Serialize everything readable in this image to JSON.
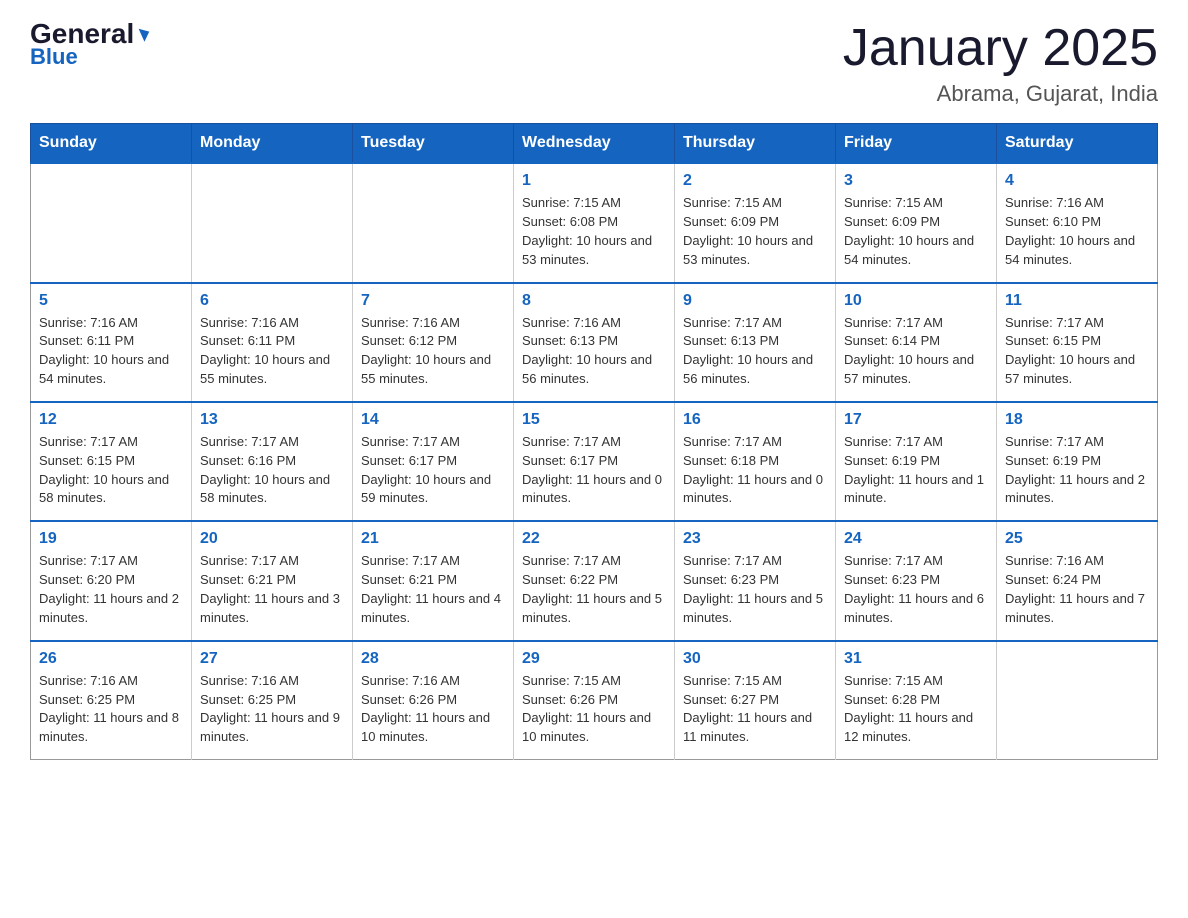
{
  "header": {
    "logo_line1": "General",
    "logo_line2": "Blue",
    "month_title": "January 2025",
    "location": "Abrama, Gujarat, India"
  },
  "days_of_week": [
    "Sunday",
    "Monday",
    "Tuesday",
    "Wednesday",
    "Thursday",
    "Friday",
    "Saturday"
  ],
  "weeks": [
    [
      {
        "day": "",
        "info": ""
      },
      {
        "day": "",
        "info": ""
      },
      {
        "day": "",
        "info": ""
      },
      {
        "day": "1",
        "info": "Sunrise: 7:15 AM\nSunset: 6:08 PM\nDaylight: 10 hours\nand 53 minutes."
      },
      {
        "day": "2",
        "info": "Sunrise: 7:15 AM\nSunset: 6:09 PM\nDaylight: 10 hours\nand 53 minutes."
      },
      {
        "day": "3",
        "info": "Sunrise: 7:15 AM\nSunset: 6:09 PM\nDaylight: 10 hours\nand 54 minutes."
      },
      {
        "day": "4",
        "info": "Sunrise: 7:16 AM\nSunset: 6:10 PM\nDaylight: 10 hours\nand 54 minutes."
      }
    ],
    [
      {
        "day": "5",
        "info": "Sunrise: 7:16 AM\nSunset: 6:11 PM\nDaylight: 10 hours\nand 54 minutes."
      },
      {
        "day": "6",
        "info": "Sunrise: 7:16 AM\nSunset: 6:11 PM\nDaylight: 10 hours\nand 55 minutes."
      },
      {
        "day": "7",
        "info": "Sunrise: 7:16 AM\nSunset: 6:12 PM\nDaylight: 10 hours\nand 55 minutes."
      },
      {
        "day": "8",
        "info": "Sunrise: 7:16 AM\nSunset: 6:13 PM\nDaylight: 10 hours\nand 56 minutes."
      },
      {
        "day": "9",
        "info": "Sunrise: 7:17 AM\nSunset: 6:13 PM\nDaylight: 10 hours\nand 56 minutes."
      },
      {
        "day": "10",
        "info": "Sunrise: 7:17 AM\nSunset: 6:14 PM\nDaylight: 10 hours\nand 57 minutes."
      },
      {
        "day": "11",
        "info": "Sunrise: 7:17 AM\nSunset: 6:15 PM\nDaylight: 10 hours\nand 57 minutes."
      }
    ],
    [
      {
        "day": "12",
        "info": "Sunrise: 7:17 AM\nSunset: 6:15 PM\nDaylight: 10 hours\nand 58 minutes."
      },
      {
        "day": "13",
        "info": "Sunrise: 7:17 AM\nSunset: 6:16 PM\nDaylight: 10 hours\nand 58 minutes."
      },
      {
        "day": "14",
        "info": "Sunrise: 7:17 AM\nSunset: 6:17 PM\nDaylight: 10 hours\nand 59 minutes."
      },
      {
        "day": "15",
        "info": "Sunrise: 7:17 AM\nSunset: 6:17 PM\nDaylight: 11 hours\nand 0 minutes."
      },
      {
        "day": "16",
        "info": "Sunrise: 7:17 AM\nSunset: 6:18 PM\nDaylight: 11 hours\nand 0 minutes."
      },
      {
        "day": "17",
        "info": "Sunrise: 7:17 AM\nSunset: 6:19 PM\nDaylight: 11 hours\nand 1 minute."
      },
      {
        "day": "18",
        "info": "Sunrise: 7:17 AM\nSunset: 6:19 PM\nDaylight: 11 hours\nand 2 minutes."
      }
    ],
    [
      {
        "day": "19",
        "info": "Sunrise: 7:17 AM\nSunset: 6:20 PM\nDaylight: 11 hours\nand 2 minutes."
      },
      {
        "day": "20",
        "info": "Sunrise: 7:17 AM\nSunset: 6:21 PM\nDaylight: 11 hours\nand 3 minutes."
      },
      {
        "day": "21",
        "info": "Sunrise: 7:17 AM\nSunset: 6:21 PM\nDaylight: 11 hours\nand 4 minutes."
      },
      {
        "day": "22",
        "info": "Sunrise: 7:17 AM\nSunset: 6:22 PM\nDaylight: 11 hours\nand 5 minutes."
      },
      {
        "day": "23",
        "info": "Sunrise: 7:17 AM\nSunset: 6:23 PM\nDaylight: 11 hours\nand 5 minutes."
      },
      {
        "day": "24",
        "info": "Sunrise: 7:17 AM\nSunset: 6:23 PM\nDaylight: 11 hours\nand 6 minutes."
      },
      {
        "day": "25",
        "info": "Sunrise: 7:16 AM\nSunset: 6:24 PM\nDaylight: 11 hours\nand 7 minutes."
      }
    ],
    [
      {
        "day": "26",
        "info": "Sunrise: 7:16 AM\nSunset: 6:25 PM\nDaylight: 11 hours\nand 8 minutes."
      },
      {
        "day": "27",
        "info": "Sunrise: 7:16 AM\nSunset: 6:25 PM\nDaylight: 11 hours\nand 9 minutes."
      },
      {
        "day": "28",
        "info": "Sunrise: 7:16 AM\nSunset: 6:26 PM\nDaylight: 11 hours\nand 10 minutes."
      },
      {
        "day": "29",
        "info": "Sunrise: 7:15 AM\nSunset: 6:26 PM\nDaylight: 11 hours\nand 10 minutes."
      },
      {
        "day": "30",
        "info": "Sunrise: 7:15 AM\nSunset: 6:27 PM\nDaylight: 11 hours\nand 11 minutes."
      },
      {
        "day": "31",
        "info": "Sunrise: 7:15 AM\nSunset: 6:28 PM\nDaylight: 11 hours\nand 12 minutes."
      },
      {
        "day": "",
        "info": ""
      }
    ]
  ]
}
